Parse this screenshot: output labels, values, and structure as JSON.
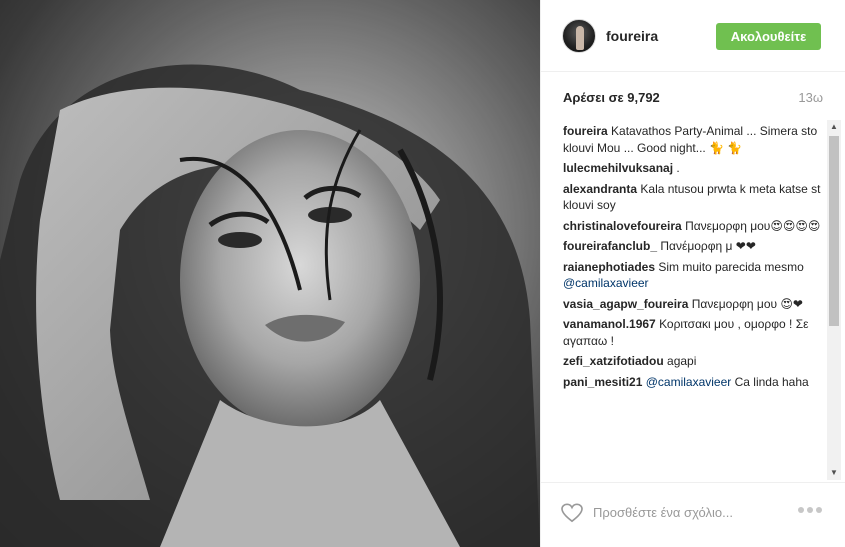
{
  "post": {
    "photo_icon": "photo-portrait",
    "header": {
      "username": "foureira",
      "follow_label": "Ακολουθείτε",
      "follow_color": "#70c050"
    },
    "likes": {
      "label": "Αρέσει σε 9,792",
      "time_ago": "13ω"
    },
    "comments": [
      {
        "user": "foureira",
        "text": "Katavathos Party-Animal ... Simera sto klouvi Mou ... Good night... 🐈 🐈",
        "mention": ""
      },
      {
        "user": "lulecmehilvuksanaj",
        "text": ".",
        "mention": ""
      },
      {
        "user": "alexandranta",
        "text": "Kala ntusou prwta k meta katse st klouvi soy",
        "mention": ""
      },
      {
        "user": "christinalovefoureira",
        "text": "Πανεμορφη μου😍😍😍😍",
        "mention": ""
      },
      {
        "user": "foureirafanclub_",
        "text": "Πανέμορφη μ ❤❤",
        "mention": ""
      },
      {
        "user": "raianephotiades",
        "text": "Sim muito parecida mesmo",
        "mention": "@camilaxavieer"
      },
      {
        "user": "vasia_agapw_foureira",
        "text": "Πανεμορφη μου 😍❤",
        "mention": ""
      },
      {
        "user": "vanamanol.1967",
        "text": "Κοριτσακι μου , ομορφο ! Σε αγαπαω !",
        "mention": ""
      },
      {
        "user": "zefi_xatzifotiadou",
        "text": "agapi",
        "mention": ""
      },
      {
        "user": "pani_mesiti21",
        "text": "Ca linda haha",
        "mention": "@camilaxavieer"
      }
    ],
    "footer": {
      "placeholder": "Προσθέστε ένα σχόλιο...",
      "like_icon": "heart-outline-icon",
      "more_icon": "more-options-icon"
    }
  }
}
